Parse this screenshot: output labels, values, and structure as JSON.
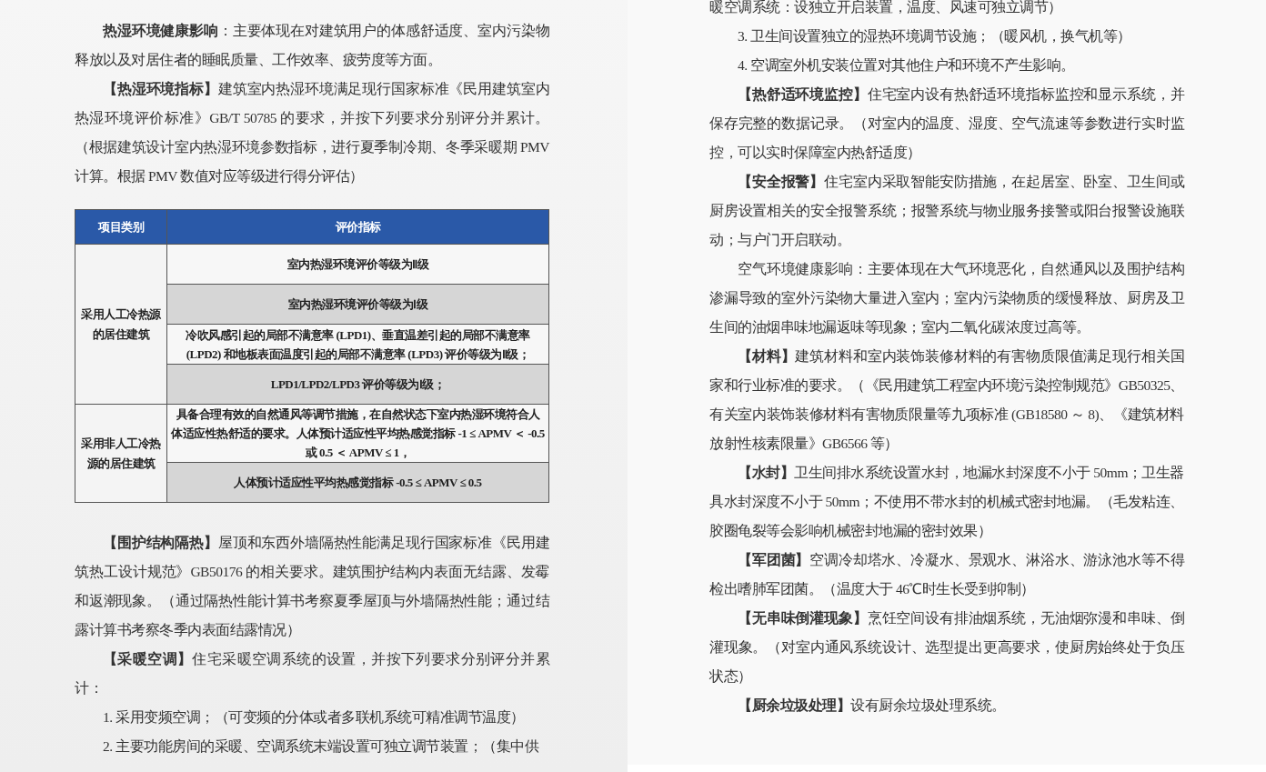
{
  "left_page": {
    "blocks": [
      {
        "kind": "paragraph",
        "text": "**热湿环境健康影响**：主要体现在对建筑用户的体感舒适度、室内污染物释放以及对居住者的睡眠质量、工作效率、疲劳度等方面。"
      },
      {
        "kind": "paragraph",
        "text": "**【热湿环境指标】**建筑室内热湿环境满足现行国家标准《民用建筑室内热湿环境评价标准》GB/T 50785 的要求，并按下列要求分别评分并累计。（根据建筑设计室内热湿环境参数指标，进行夏季制冷期、冬季采暖期 PMV 计算。根据 PMV 数值对应等级进行得分评估）"
      },
      {
        "kind": "table",
        "columns": [
          "项目类别",
          "评价指标"
        ],
        "groups": [
          {
            "category": "采用人工冷热源的居住建筑",
            "rows": [
              {
                "text": "室内热湿环境评价等级为Ⅱ级",
                "shaded": false
              },
              {
                "text": "室内热湿环境评价等级为Ⅰ级",
                "shaded": true
              },
              {
                "text": "冷吹风感引起的局部不满意率 (LPD1)、垂直温差引起的局部不满意率 (LPD2) 和地板表面温度引起的局部不满意率 (LPD3) 评价等级为Ⅱ级；",
                "shaded": false
              },
              {
                "text": "LPD1/LPD2/LPD3 评价等级为Ⅰ级；",
                "shaded": true
              }
            ]
          },
          {
            "category": "采用非人工冷热源的居住建筑",
            "rows": [
              {
                "text": "具备合理有效的自然通风等调节措施，在自然状态下室内热湿环境符合人体适应性热舒适的要求。人体预计适应性平均热感觉指标 -1 ≤ APMV ＜ -0.5 或 0.5 ＜ APMV ≤ 1，",
                "shaded": false
              },
              {
                "text": "人体预计适应性平均热感觉指标 -0.5 ≤ APMV ≤ 0.5",
                "shaded": true
              }
            ]
          }
        ]
      },
      {
        "kind": "paragraph",
        "text": "**【围护结构隔热】**屋顶和东西外墙隔热性能满足现行国家标准《民用建筑热工设计规范》GB50176 的相关要求。建筑围护结构内表面无结露、发霉和返潮现象。（通过隔热性能计算书考察夏季屋顶与外墙隔热性能；通过结露计算书考察冬季内表面结露情况）"
      },
      {
        "kind": "paragraph",
        "text": "**【采暖空调】**住宅采暖空调系统的设置，并按下列要求分别评分并累计："
      },
      {
        "kind": "list_item",
        "text": "1. 采用变频空调；（可变频的分体或者多联机系统可精准调节温度）"
      },
      {
        "kind": "list_item",
        "text": "2. 主要功能房间的采暖、空调系统末端设置可独立调节装置；（集中供"
      }
    ]
  },
  "right_page": {
    "blocks": [
      {
        "kind": "continuation",
        "text": "暖空调系统：设独立开启装置，温度、风速可独立调节）"
      },
      {
        "kind": "list_item",
        "text": "3. 卫生间设置独立的湿热环境调节设施；（暖风机，换气机等）"
      },
      {
        "kind": "list_item",
        "text": "4. 空调室外机安装位置对其他住户和环境不产生影响。"
      },
      {
        "kind": "paragraph",
        "text": "**【热舒适环境监控】**住宅室内设有热舒适环境指标监控和显示系统，并保存完整的数据记录。（对室内的温度、湿度、空气流速等参数进行实时监控，可以实时保障室内热舒适度）"
      },
      {
        "kind": "paragraph",
        "text": "**【安全报警】**住宅室内采取智能安防措施，在起居室、卧室、卫生间或厨房设置相关的安全报警系统；报警系统与物业服务接警或阳台报警设施联动；与户门开启联动。"
      },
      {
        "kind": "paragraph",
        "text": "空气环境健康影响：主要体现在大气环境恶化，自然通风以及围护结构渗漏导致的室外污染物大量进入室内；室内污染物质的缓慢释放、厨房及卫生间的油烟串味地漏返味等现象；室内二氧化碳浓度过高等。"
      },
      {
        "kind": "paragraph",
        "text": "**【材料】**建筑材料和室内装饰装修材料的有害物质限值满足现行相关国家和行业标准的要求。（《民用建筑工程室内环境污染控制规范》GB50325、有关室内装饰装修材料有害物质限量等九项标准 (GB18580 ～ 8)、《建筑材料放射性核素限量》GB6566 等）"
      },
      {
        "kind": "paragraph",
        "text": "**【水封】**卫生间排水系统设置水封，地漏水封深度不小于 50mm；卫生器具水封深度不小于 50mm；不使用不带水封的机械式密封地漏。（毛发粘连、胶圈龟裂等会影响机械密封地漏的密封效果）"
      },
      {
        "kind": "paragraph",
        "text": "**【军团菌】**空调冷却塔水、冷凝水、景观水、淋浴水、游泳池水等不得检出嗜肺军团菌。（温度大于 46℃时生长受到抑制）"
      },
      {
        "kind": "paragraph",
        "text": "**【无串味倒灌现象】**烹饪空间设有排油烟系统，无油烟弥漫和串味、倒灌现象。（对室内通风系统设计、选型提出更高要求，使厨房始终处于负压状态）"
      },
      {
        "kind": "paragraph",
        "text": "**【厨余垃圾处理】**设有厨余垃圾处理系统。"
      }
    ]
  }
}
